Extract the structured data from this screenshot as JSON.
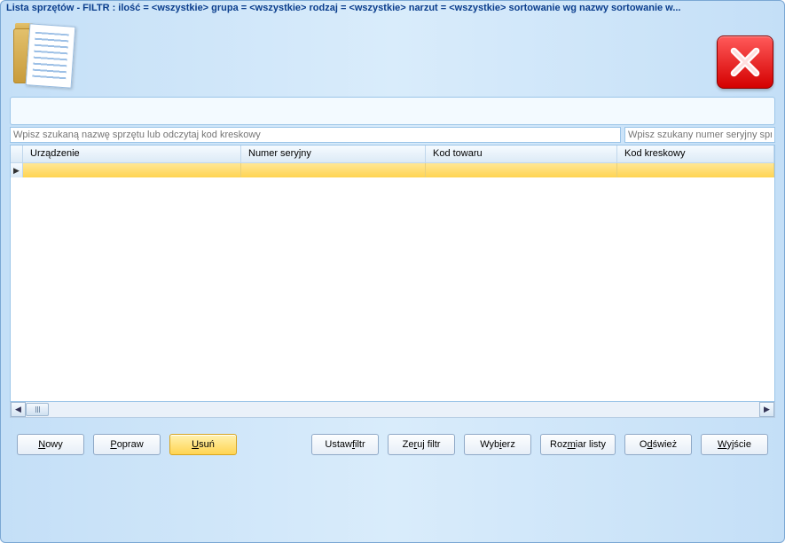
{
  "title": "Lista sprzętów  -  FILTR : ilość = <wszystkie>   grupa  = <wszystkie>   rodzaj = <wszystkie>   narzut = <wszystkie>  sortowanie wg nazwy sortowanie w...",
  "search": {
    "name_placeholder": "Wpisz szukaną nazwę sprzętu lub odczytaj kod kreskowy",
    "serial_placeholder": "Wpisz szukany numer seryjny sprz"
  },
  "columns": {
    "device": "Urządzenie",
    "serial": "Numer seryjny",
    "product_code": "Kod towaru",
    "barcode": "Kod kreskowy"
  },
  "buttons": {
    "new": {
      "pre": "",
      "u": "N",
      "post": "owy"
    },
    "edit": {
      "pre": "",
      "u": "P",
      "post": "opraw"
    },
    "delete": {
      "pre": "",
      "u": "U",
      "post": "suń"
    },
    "set_filter": {
      "pre": "Ustaw ",
      "u": "f",
      "post": "iltr"
    },
    "clear_filter": {
      "pre": "Ze",
      "u": "r",
      "post": "uj filtr"
    },
    "select": {
      "pre": "Wyb",
      "u": "i",
      "post": "erz"
    },
    "list_size": {
      "pre": "Roz",
      "u": "m",
      "post": "iar listy"
    },
    "refresh": {
      "pre": "O",
      "u": "d",
      "post": "śwież"
    },
    "exit": {
      "pre": "",
      "u": "W",
      "post": "yjście"
    }
  },
  "row_indicator": "▶"
}
